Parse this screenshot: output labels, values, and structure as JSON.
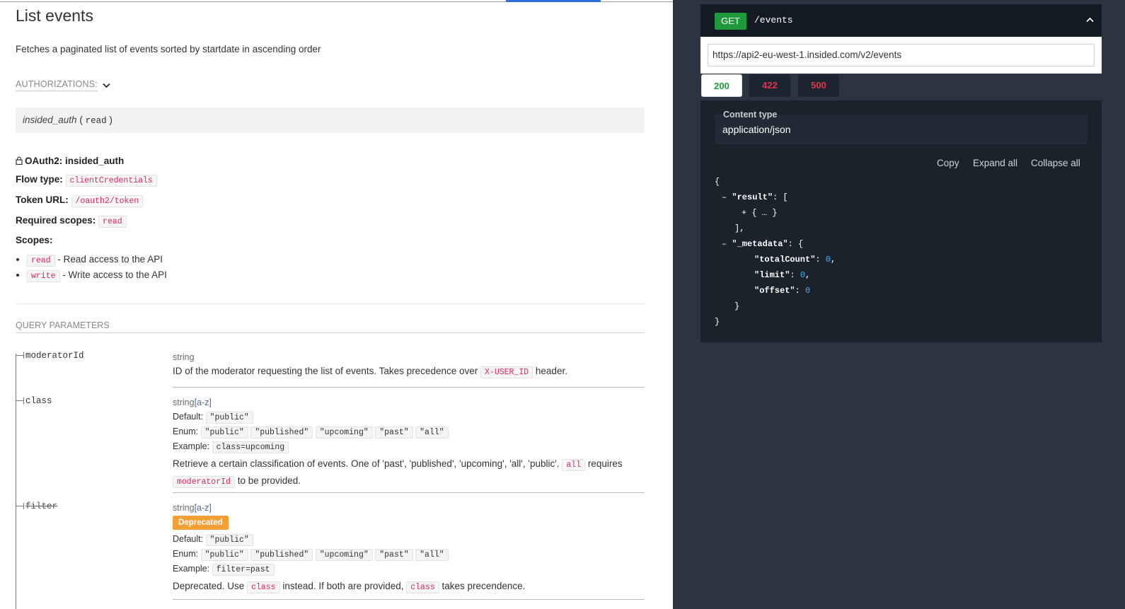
{
  "operation": {
    "title": "List events",
    "description": "Fetches a paginated list of events sorted by startdate in ascending order"
  },
  "authorizations": {
    "toggle_label": "AUTHORIZATIONS:",
    "scheme_name": "insided_auth",
    "scheme_open": "(",
    "scheme_scope": "read",
    "scheme_close": ")"
  },
  "oauth": {
    "title": "OAuth2: insided_auth",
    "flow_label": "Flow type:",
    "flow_value": "clientCredentials",
    "token_label": "Token URL:",
    "token_value": "/oauth2/token",
    "required_label": "Required scopes:",
    "required_value": "read",
    "scopes_label": "Scopes:",
    "scopes": [
      {
        "name": "read",
        "desc": "- Read access to the API"
      },
      {
        "name": "write",
        "desc": "- Write access to the API"
      }
    ]
  },
  "query_params": {
    "title": "QUERY PARAMETERS",
    "labels": {
      "default": "Default:",
      "enum": "Enum:",
      "example": "Example:"
    },
    "items": [
      {
        "name": "moderatorId",
        "type": "string",
        "desc_pre": "ID of the moderator requesting the list of events. Takes precedence over",
        "desc_code": "X-USER_ID",
        "desc_post": "header."
      },
      {
        "name": "class",
        "type": "string",
        "format": "[a-z]",
        "default": "\"public\"",
        "enum": [
          "\"public\"",
          "\"published\"",
          "\"upcoming\"",
          "\"past\"",
          "\"all\""
        ],
        "example": "class=upcoming",
        "desc_pre": "Retrieve a certain classification of events. One of 'past', 'published', 'upcoming', 'all', 'public'.",
        "desc_code1": "all",
        "desc_mid": "requires",
        "desc_code2": "moderatorId",
        "desc_post": "to be provided."
      },
      {
        "name": "filter",
        "type": "string",
        "format": "[a-z]",
        "badge": "Deprecated",
        "default": "\"public\"",
        "enum": [
          "\"public\"",
          "\"published\"",
          "\"upcoming\"",
          "\"past\"",
          "\"all\""
        ],
        "example": "filter=past",
        "desc_pre": "Deprecated. Use",
        "desc_code1": "class",
        "desc_mid": "instead. If both are provided,",
        "desc_code2": "class",
        "desc_post": "takes precendence."
      }
    ]
  },
  "request": {
    "method": "GET",
    "path": "/events",
    "url": "https://api2-eu-west-1.insided.com/v2/events"
  },
  "responses": {
    "tabs": [
      "200",
      "422",
      "500"
    ],
    "content_type_label": "Content type",
    "content_type_value": "application/json",
    "actions": [
      "Copy",
      "Expand all",
      "Collapse all"
    ],
    "json_sample": {
      "open": "{",
      "result_key": "\"result\"",
      "result_open": ": [",
      "collapsed": "+ { … }",
      "result_close": "],",
      "metadata_key": "\"_metadata\"",
      "metadata_open": ": {",
      "total_key": "\"totalCount\"",
      "total_val": "0",
      "limit_key": "\"limit\"",
      "limit_val": "0",
      "offset_key": "\"offset\"",
      "offset_val": "0",
      "inner_close": "}",
      "close": "}",
      "collapse_marker": "–"
    }
  },
  "colors": {
    "method_get": "#1e9a3c",
    "status_ok": "#1e9a3c",
    "status_error": "#e0344c",
    "deprecated_badge": "#f5a037",
    "code_text": "#e0245e",
    "panel_dark": "#2b3441"
  }
}
